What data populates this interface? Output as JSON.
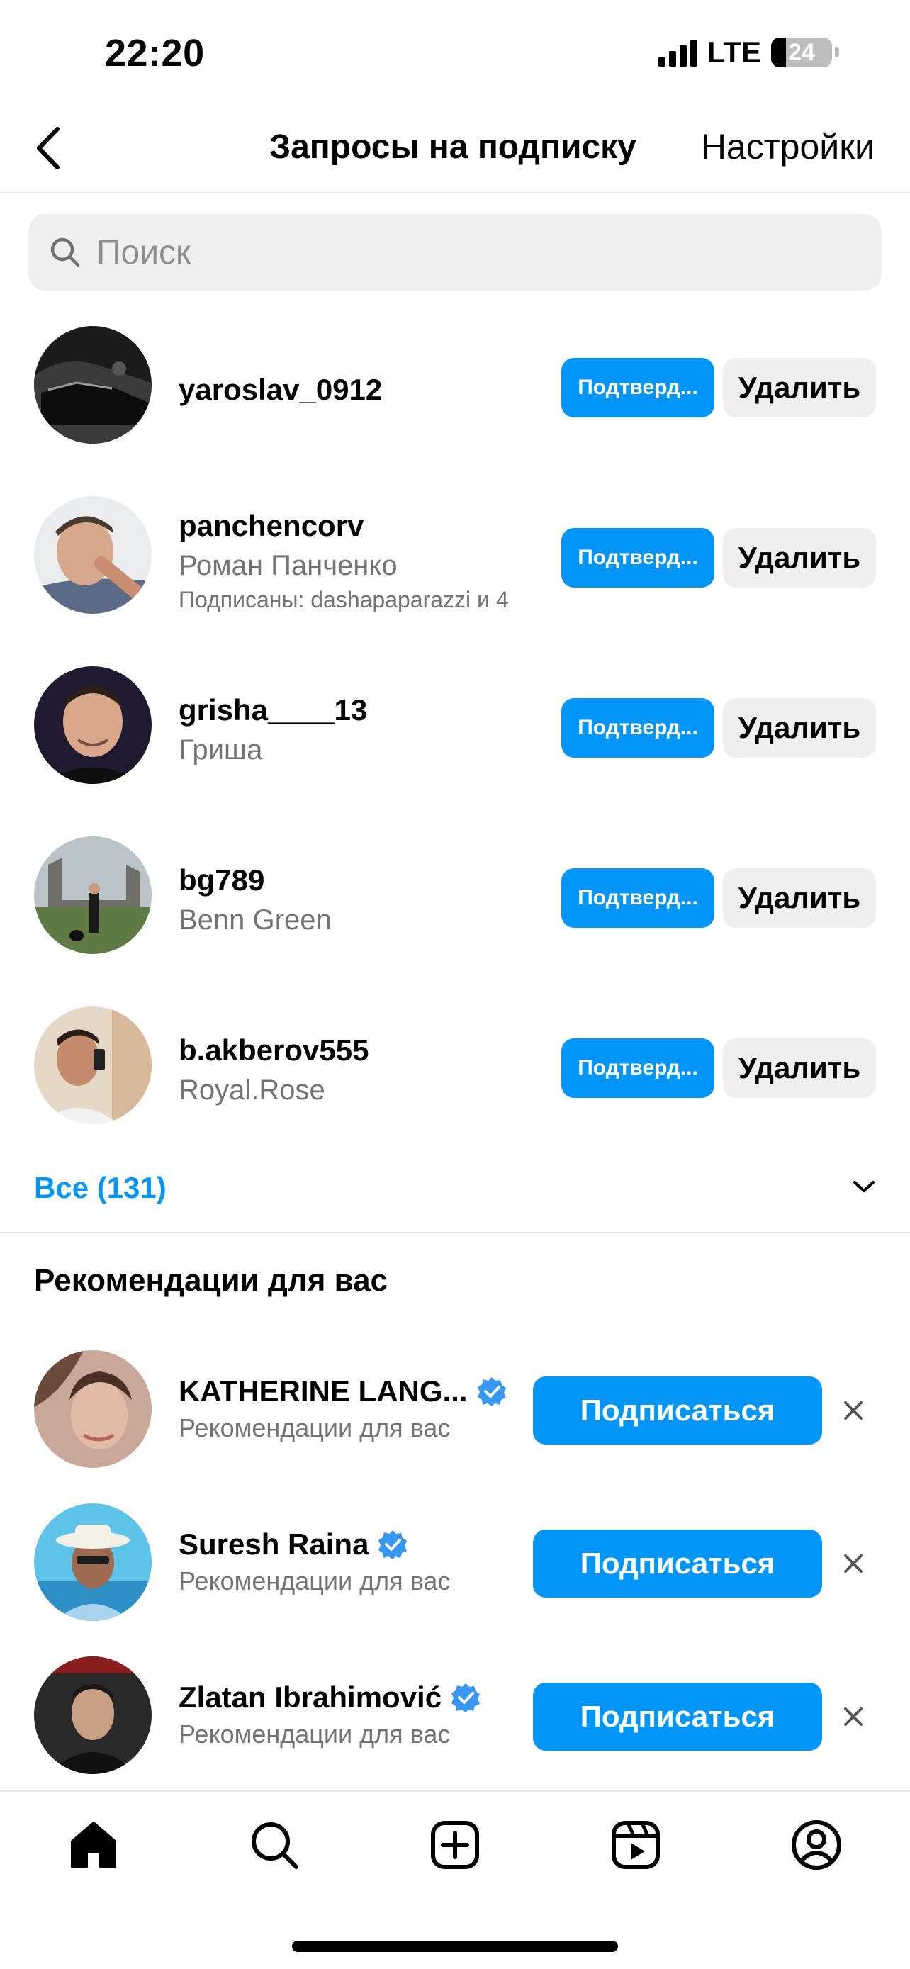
{
  "status_bar": {
    "time": "22:20",
    "network": "LTE",
    "battery_level": "24"
  },
  "header": {
    "back_icon": "chevron-left-icon",
    "title": "Запросы на подписку",
    "settings_label": "Настройки"
  },
  "search": {
    "icon": "search-icon",
    "placeholder": "Поиск",
    "value": ""
  },
  "requests": [
    {
      "username": "yaroslav_0912",
      "full_name": "",
      "mutual": "",
      "confirm_label": "Подтверд...",
      "delete_label": "Удалить"
    },
    {
      "username": "panchencorv",
      "full_name": "Роман Панченко",
      "mutual": "Подписаны: dashapaparazzi и 4",
      "confirm_label": "Подтверд...",
      "delete_label": "Удалить"
    },
    {
      "username": "grisha____13",
      "full_name": "Гриша",
      "mutual": "",
      "confirm_label": "Подтверд...",
      "delete_label": "Удалить"
    },
    {
      "username": "bg789",
      "full_name": "Benn Green",
      "mutual": "",
      "confirm_label": "Подтверд...",
      "delete_label": "Удалить"
    },
    {
      "username": "b.akberov555",
      "full_name": "Royal.Rose",
      "mutual": "",
      "confirm_label": "Подтверд...",
      "delete_label": "Удалить"
    }
  ],
  "see_all": {
    "label": "Все (131)",
    "icon": "chevron-down-icon"
  },
  "recommendations": {
    "title": "Рекомендации для вас",
    "items": [
      {
        "name": "KATHERINE LANG...",
        "verified": true,
        "subtitle": "Рекомендации для вас",
        "follow_label": "Подписаться"
      },
      {
        "name": "Suresh Raina",
        "verified": true,
        "subtitle": "Рекомендации для вас",
        "follow_label": "Подписаться"
      },
      {
        "name": "Zlatan Ibrahimović",
        "verified": true,
        "subtitle": "Рекомендации для вас",
        "follow_label": "Подписаться"
      }
    ]
  },
  "tab_bar": {
    "tabs": [
      "home-icon",
      "search-icon",
      "create-post-icon",
      "reels-icon",
      "profile-icon"
    ]
  },
  "colors": {
    "accent": "#0095f6",
    "secondary_text": "#737373",
    "button_gray": "#efefef",
    "verified": "#3897f0"
  }
}
